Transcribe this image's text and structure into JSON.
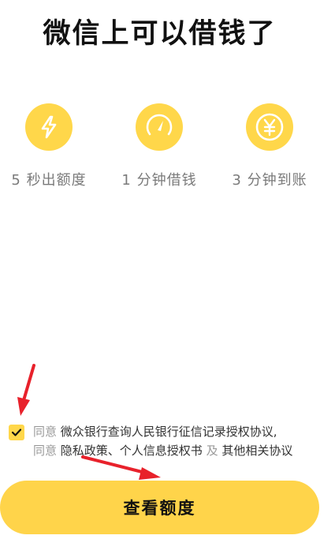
{
  "header": {
    "title": "微信上可以借钱了"
  },
  "features": [
    {
      "icon": "lightning-icon",
      "label": "5 秒出额度"
    },
    {
      "icon": "speedometer-icon",
      "label": "1 分钟借钱"
    },
    {
      "icon": "yuan-coin-icon",
      "label": "3 分钟到账"
    }
  ],
  "agreement": {
    "checked": true,
    "line1_prefix": "同意",
    "line1_link": "微众银行查询人民银行征信记录授权协议,",
    "line2_prefix": "同意",
    "line2_link": "隐私政策、个人信息授权书",
    "line2_and": "及",
    "line2_link2": "其他相关协议"
  },
  "cta": {
    "label": "查看额度"
  },
  "colors": {
    "accent": "#FFD74A",
    "title": "#111111",
    "muted": "#9A9A9A",
    "annotation_arrow": "#E8212B"
  }
}
